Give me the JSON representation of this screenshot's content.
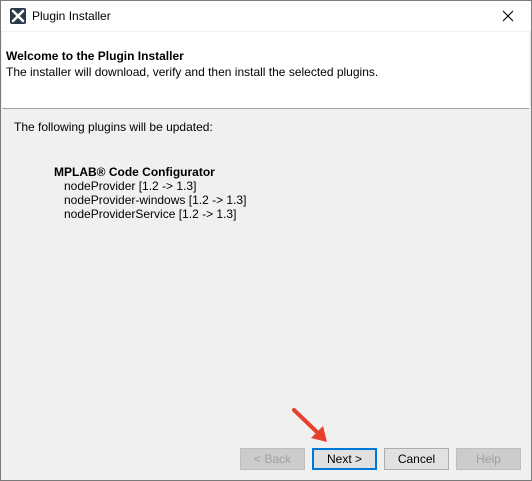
{
  "window": {
    "title": "Plugin Installer",
    "app_icon": "mplab-x-icon",
    "close_icon": "close-icon"
  },
  "header": {
    "title": "Welcome to the Plugin Installer",
    "description": "The installer will download, verify and then install the selected plugins."
  },
  "content": {
    "intro": "The following plugins will be updated:",
    "plugin_name": "MPLAB® Code Configurator",
    "modules": [
      "nodeProvider [1.2 -> 1.3]",
      "nodeProvider-windows [1.2 -> 1.3]",
      "nodeProviderService [1.2 -> 1.3]"
    ]
  },
  "buttons": {
    "back": "< Back",
    "next": "Next >",
    "cancel": "Cancel",
    "help": "Help"
  },
  "colors": {
    "annotation_arrow": "#e8402f",
    "default_button_border": "#0078d7"
  }
}
